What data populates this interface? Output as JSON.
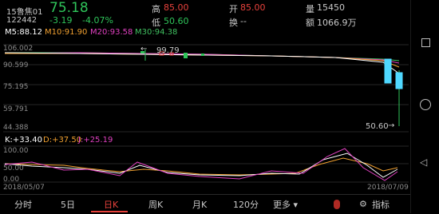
{
  "header": {
    "name": "15鲁焦01",
    "code": "122442",
    "price": "75.18",
    "change": "-3.19",
    "change_pct": "-4.07%",
    "high_label": "高",
    "high_value": "85.00",
    "low_label": "低",
    "low_value": "50.60",
    "open_label": "开",
    "open_value": "85.00",
    "turnover_label": "换",
    "turnover_value": "--",
    "volume_label": "量",
    "volume_value": "15450",
    "amount_label": "额",
    "amount_value": "1066.9万"
  },
  "ma": {
    "m5": "M5:88.12",
    "m10": "M10:91.90",
    "m20": "M20:93.58",
    "m30": "M30:94.38"
  },
  "price_axis": [
    "106.002",
    "90.599",
    "75.195",
    "59.791",
    "44.388"
  ],
  "annotations": {
    "high_arrow": "←",
    "high_value": "99.79",
    "low_value": "50.60",
    "low_arrow": "→"
  },
  "kdj": {
    "k": "K:+33.40",
    "d": "D:+37.50",
    "j": "J:+25.19",
    "axis_top": "100.00",
    "axis_mid": "50.00",
    "axis_bottom": "0.00"
  },
  "dates": {
    "start": "2018/05/07",
    "end": "2018/07/09"
  },
  "tabs": [
    {
      "label": "分时"
    },
    {
      "label": "5日"
    },
    {
      "label": "日K"
    },
    {
      "label": "周K"
    },
    {
      "label": "月K"
    },
    {
      "label": "120分"
    },
    {
      "label": "更多 ▾"
    },
    {
      "label": "指标"
    }
  ],
  "colors": {
    "up": "#e8423c",
    "down": "#2fc55a",
    "ma5": "#ffffff",
    "ma10": "#f0a030",
    "ma20": "#e040c0",
    "ma30": "#40c060",
    "k_line": "#ffffff",
    "d_line": "#f0a030",
    "j_line": "#e040c0"
  }
}
